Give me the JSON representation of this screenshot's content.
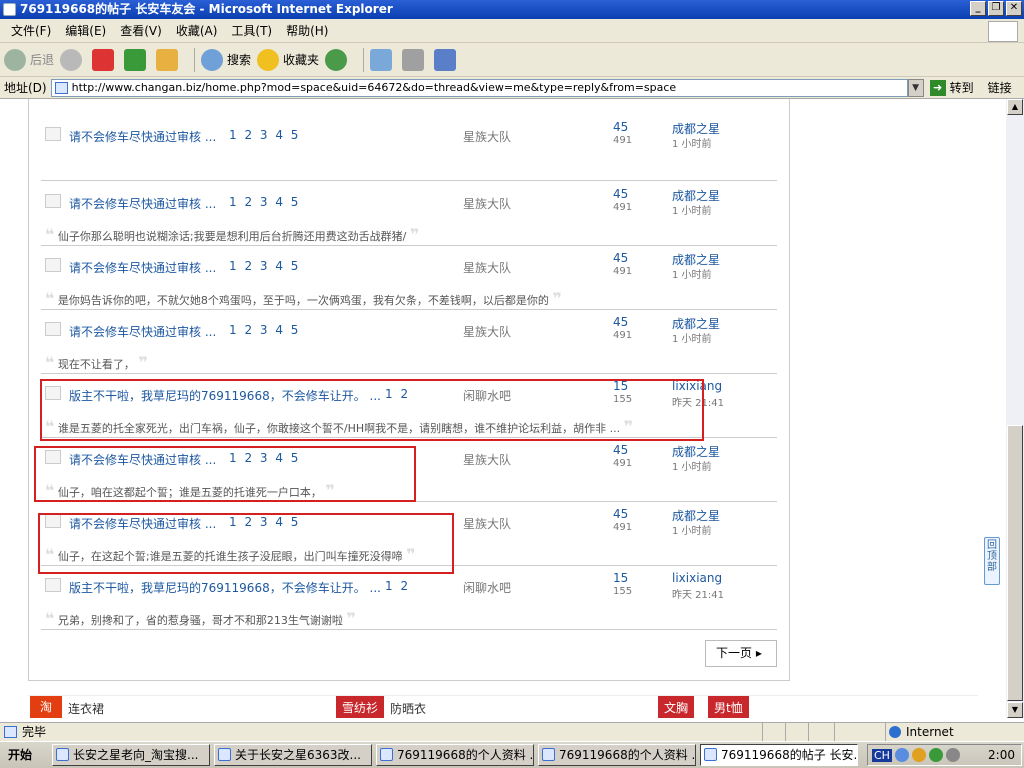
{
  "window": {
    "title": "769119668的帖子 长安车友会 - Microsoft Internet Explorer",
    "min": "_",
    "max": "❐",
    "close": "✕"
  },
  "menu": [
    "文件(F)",
    "编辑(E)",
    "查看(V)",
    "收藏(A)",
    "工具(T)",
    "帮助(H)"
  ],
  "toolbar": {
    "back": "后退",
    "search": "搜索",
    "favorites": "收藏夹"
  },
  "address": {
    "label": "地址(D)",
    "url": "http://www.changan.biz/home.php?mod=space&uid=64672&do=thread&view=me&type=reply&from=space",
    "go": "转到",
    "links": "链接"
  },
  "threads": [
    {
      "title": "请不会修车尽快通过审核 ...",
      "pages": "1 2 3 4 5",
      "forum": "星族大队",
      "replies": "45",
      "views": "491",
      "author": "成都之星",
      "time": "1 小时前",
      "quote": ""
    },
    {
      "title": "请不会修车尽快通过审核 ...",
      "pages": "1 2 3 4 5",
      "forum": "星族大队",
      "replies": "45",
      "views": "491",
      "author": "成都之星",
      "time": "1 小时前",
      "quote": "仙子你那么聪明也说糊涂话;我要是想利用后台折腾还用费这劲舌战群猪/"
    },
    {
      "title": "请不会修车尽快通过审核 ...",
      "pages": "1 2 3 4 5",
      "forum": "星族大队",
      "replies": "45",
      "views": "491",
      "author": "成都之星",
      "time": "1 小时前",
      "quote": "是你妈告诉你的吧，不就欠她8个鸡蛋吗，至于吗，一次俩鸡蛋，我有欠条，不差钱啊，以后都是你的"
    },
    {
      "title": "请不会修车尽快通过审核 ...",
      "pages": "1 2 3 4 5",
      "forum": "星族大队",
      "replies": "45",
      "views": "491",
      "author": "成都之星",
      "time": "1 小时前",
      "quote": "现在不让看了，"
    },
    {
      "title": "版主不干啦，我草尼玛的769119668，不会修车让开。 ...",
      "pages": "1 2",
      "forum": "闲聊水吧",
      "replies": "15",
      "views": "155",
      "author": "lixixiang",
      "time": "昨天 21:41",
      "quote": "谁是五菱的托全家死光，出门车祸，仙子，你敢接这个誓不/HH啊我不是，请别瞎想，谁不维护论坛利益，胡作非 ..."
    },
    {
      "title": "请不会修车尽快通过审核 ...",
      "pages": "1 2 3 4 5",
      "forum": "星族大队",
      "replies": "45",
      "views": "491",
      "author": "成都之星",
      "time": "1 小时前",
      "quote": "仙子，咱在这都起个誓；谁是五菱的托谁死一户口本，"
    },
    {
      "title": "请不会修车尽快通过审核 ...",
      "pages": "1 2 3 4 5",
      "forum": "星族大队",
      "replies": "45",
      "views": "491",
      "author": "成都之星",
      "time": "1 小时前",
      "quote": "仙子，在这起个誓;谁是五菱的托谁生孩子没屁眼，出门叫车撞死没得啼"
    },
    {
      "title": "版主不干啦，我草尼玛的769119668，不会修车让开。 ...",
      "pages": "1 2",
      "forum": "闲聊水吧",
      "replies": "15",
      "views": "155",
      "author": "lixixiang",
      "time": "昨天 21:41",
      "quote": "兄弟，别搀和了，省的惹身骚，哥才不和那213生气谢谢啦"
    }
  ],
  "next_page": "下一页",
  "ads": {
    "dress": "连衣裙",
    "chiffon": "雪纺衫",
    "sunproof": "防晒衣",
    "bra": "文胸",
    "tshirt": "男t恤"
  },
  "back_to_top": "回顶部",
  "status": {
    "text": "完毕",
    "zone": "Internet"
  },
  "taskbar": {
    "start": "开始",
    "tasks": [
      "长安之星老向_淘宝搜...",
      "关于长安之星6363改...",
      "769119668的个人资料 ...",
      "769119668的个人资料 ...",
      "769119668的帖子 长安..."
    ],
    "clock": "2:00",
    "ime": "CH"
  }
}
